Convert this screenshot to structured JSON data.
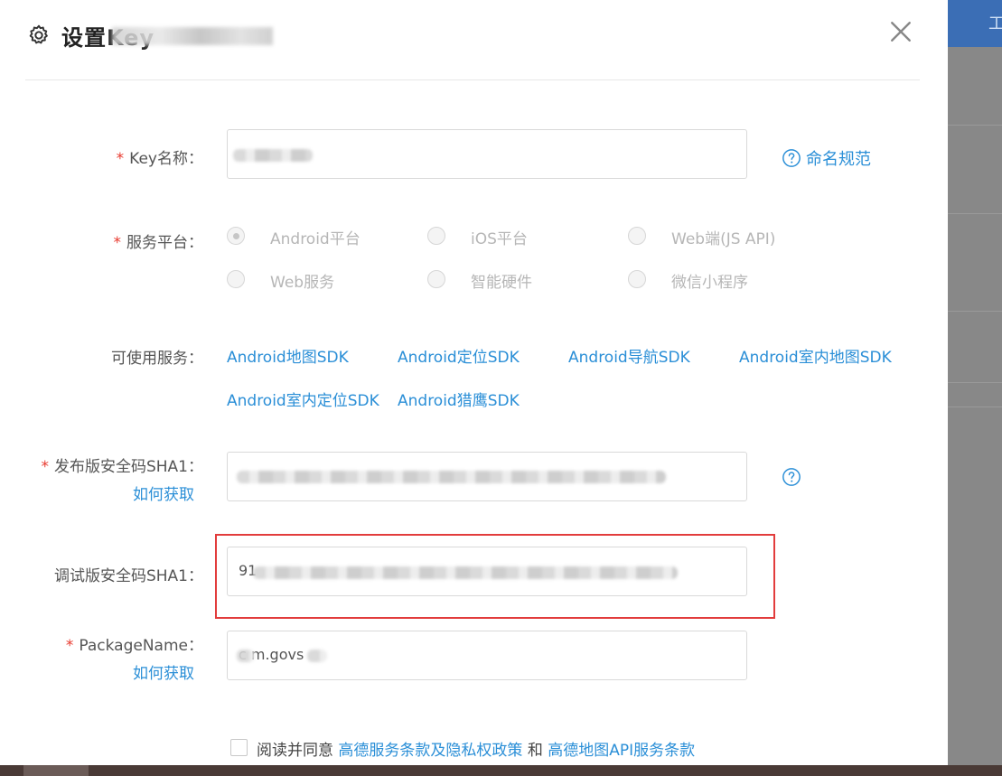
{
  "dialog": {
    "title": "设置Key",
    "close_label": "×"
  },
  "form": {
    "key_name": {
      "label": "Key名称：",
      "value": "",
      "help_text": "命名规范"
    },
    "platform": {
      "label": "服务平台：",
      "options": [
        "Android平台",
        "iOS平台",
        "Web端(JS API)",
        "Web服务",
        "智能硬件",
        "微信小程序"
      ],
      "selected": "Android平台"
    },
    "services": {
      "label": "可使用服务：",
      "items": [
        "Android地图SDK",
        "Android定位SDK",
        "Android导航SDK",
        "Android室内地图SDK",
        "Android室内定位SDK",
        "Android猎鹰SDK"
      ]
    },
    "release_sha1": {
      "label": "发布版安全码SHA1：",
      "how_to": "如何获取",
      "value": ""
    },
    "debug_sha1": {
      "label": "调试版安全码SHA1：",
      "value": "91"
    },
    "package_name": {
      "label": "PackageName：",
      "how_to": "如何获取",
      "value": "c  m.govs"
    },
    "agreement": {
      "prefix": "阅读并同意",
      "link1": "高德服务条款及隐私权政策",
      "joiner": "和",
      "link2": "高德地图API服务条款"
    }
  },
  "background": {
    "top_bar_text": "工"
  },
  "colors": {
    "accent": "#2b8fd7",
    "required": "#e8392e",
    "highlight": "#e23c3c"
  }
}
